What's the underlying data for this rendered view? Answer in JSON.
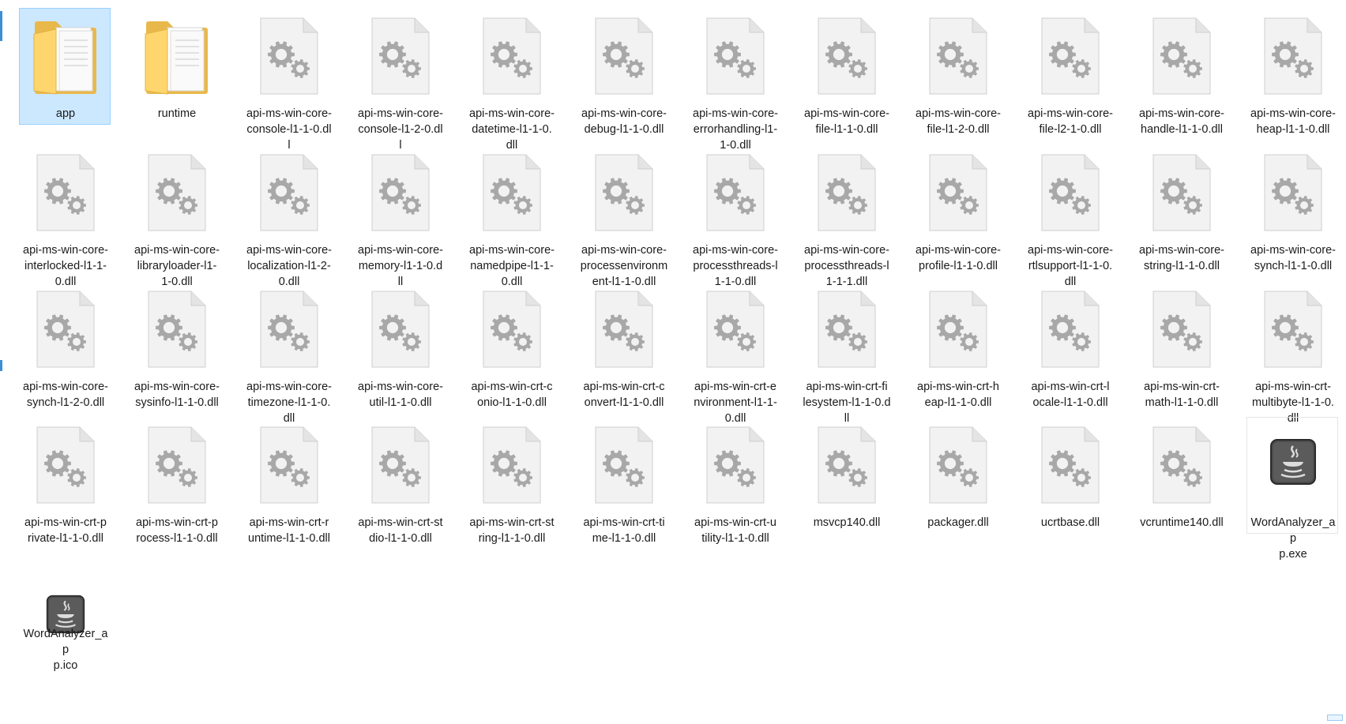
{
  "window": {
    "view": "large-icons"
  },
  "colors": {
    "selection_fill": "#cce8ff",
    "selection_border": "#99d1ff",
    "folder_front": "#ffd66e",
    "folder_back": "#e9b84a",
    "file_page": "#f2f2f2",
    "gear": "#a8a8a8"
  },
  "files": [
    {
      "name": "app",
      "label": "app",
      "icon": "folder-icon",
      "selected": true
    },
    {
      "name": "runtime",
      "label": "runtime",
      "icon": "folder-icon"
    },
    {
      "name": "api-ms-win-core-console-l1-1-0.dll",
      "label": "api-ms-win-core-\nconsole-l1-1-0.dl\nl",
      "icon": "dll-file-icon"
    },
    {
      "name": "api-ms-win-core-console-l1-2-0.dll",
      "label": "api-ms-win-core-\nconsole-l1-2-0.dl\nl",
      "icon": "dll-file-icon"
    },
    {
      "name": "api-ms-win-core-datetime-l1-1-0.dll",
      "label": "api-ms-win-core-\ndatetime-l1-1-0.\ndll",
      "icon": "dll-file-icon"
    },
    {
      "name": "api-ms-win-core-debug-l1-1-0.dll",
      "label": "api-ms-win-core-\ndebug-l1-1-0.dll",
      "icon": "dll-file-icon"
    },
    {
      "name": "api-ms-win-core-errorhandling-l1-1-0.dll",
      "label": "api-ms-win-core-\nerrorhandling-l1-\n1-0.dll",
      "icon": "dll-file-icon"
    },
    {
      "name": "api-ms-win-core-file-l1-1-0.dll",
      "label": "api-ms-win-core-\nfile-l1-1-0.dll",
      "icon": "dll-file-icon"
    },
    {
      "name": "api-ms-win-core-file-l1-2-0.dll",
      "label": "api-ms-win-core-\nfile-l1-2-0.dll",
      "icon": "dll-file-icon"
    },
    {
      "name": "api-ms-win-core-file-l2-1-0.dll",
      "label": "api-ms-win-core-\nfile-l2-1-0.dll",
      "icon": "dll-file-icon"
    },
    {
      "name": "api-ms-win-core-handle-l1-1-0.dll",
      "label": "api-ms-win-core-\nhandle-l1-1-0.dll",
      "icon": "dll-file-icon"
    },
    {
      "name": "api-ms-win-core-heap-l1-1-0.dll",
      "label": "api-ms-win-core-\nheap-l1-1-0.dll",
      "icon": "dll-file-icon"
    },
    {
      "name": "api-ms-win-core-interlocked-l1-1-0.dll",
      "label": "api-ms-win-core-\ninterlocked-l1-1-\n0.dll",
      "icon": "dll-file-icon"
    },
    {
      "name": "api-ms-win-core-libraryloader-l1-1-0.dll",
      "label": "api-ms-win-core-\nlibraryloader-l1-\n1-0.dll",
      "icon": "dll-file-icon"
    },
    {
      "name": "api-ms-win-core-localization-l1-2-0.dll",
      "label": "api-ms-win-core-\nlocalization-l1-2-\n0.dll",
      "icon": "dll-file-icon"
    },
    {
      "name": "api-ms-win-core-memory-l1-1-0.dll",
      "label": "api-ms-win-core-\nmemory-l1-1-0.d\nll",
      "icon": "dll-file-icon"
    },
    {
      "name": "api-ms-win-core-namedpipe-l1-1-0.dll",
      "label": "api-ms-win-core-\nnamedpipe-l1-1-\n0.dll",
      "icon": "dll-file-icon"
    },
    {
      "name": "api-ms-win-core-processenvironment-l1-1-0.dll",
      "label": "api-ms-win-core-\nprocessenvironm\nent-l1-1-0.dll",
      "icon": "dll-file-icon"
    },
    {
      "name": "api-ms-win-core-processthreads-l1-1-0.dll",
      "label": "api-ms-win-core-\nprocessthreads-l\n1-1-0.dll",
      "icon": "dll-file-icon"
    },
    {
      "name": "api-ms-win-core-processthreads-l1-1-1.dll",
      "label": "api-ms-win-core-\nprocessthreads-l\n1-1-1.dll",
      "icon": "dll-file-icon"
    },
    {
      "name": "api-ms-win-core-profile-l1-1-0.dll",
      "label": "api-ms-win-core-\nprofile-l1-1-0.dll",
      "icon": "dll-file-icon"
    },
    {
      "name": "api-ms-win-core-rtlsupport-l1-1-0.dll",
      "label": "api-ms-win-core-\nrtlsupport-l1-1-0.\ndll",
      "icon": "dll-file-icon"
    },
    {
      "name": "api-ms-win-core-string-l1-1-0.dll",
      "label": "api-ms-win-core-\nstring-l1-1-0.dll",
      "icon": "dll-file-icon"
    },
    {
      "name": "api-ms-win-core-synch-l1-1-0.dll",
      "label": "api-ms-win-core-\nsynch-l1-1-0.dll",
      "icon": "dll-file-icon"
    },
    {
      "name": "api-ms-win-core-synch-l1-2-0.dll",
      "label": "api-ms-win-core-\nsynch-l1-2-0.dll",
      "icon": "dll-file-icon"
    },
    {
      "name": "api-ms-win-core-sysinfo-l1-1-0.dll",
      "label": "api-ms-win-core-\nsysinfo-l1-1-0.dll",
      "icon": "dll-file-icon"
    },
    {
      "name": "api-ms-win-core-timezone-l1-1-0.dll",
      "label": "api-ms-win-core-\ntimezone-l1-1-0.\ndll",
      "icon": "dll-file-icon"
    },
    {
      "name": "api-ms-win-core-util-l1-1-0.dll",
      "label": "api-ms-win-core-\nutil-l1-1-0.dll",
      "icon": "dll-file-icon"
    },
    {
      "name": "api-ms-win-crt-conio-l1-1-0.dll",
      "label": "api-ms-win-crt-c\nonio-l1-1-0.dll",
      "icon": "dll-file-icon"
    },
    {
      "name": "api-ms-win-crt-convert-l1-1-0.dll",
      "label": "api-ms-win-crt-c\nonvert-l1-1-0.dll",
      "icon": "dll-file-icon"
    },
    {
      "name": "api-ms-win-crt-environment-l1-1-0.dll",
      "label": "api-ms-win-crt-e\nnvironment-l1-1-\n0.dll",
      "icon": "dll-file-icon"
    },
    {
      "name": "api-ms-win-crt-filesystem-l1-1-0.dll",
      "label": "api-ms-win-crt-fi\nlesystem-l1-1-0.d\nll",
      "icon": "dll-file-icon"
    },
    {
      "name": "api-ms-win-crt-heap-l1-1-0.dll",
      "label": "api-ms-win-crt-h\neap-l1-1-0.dll",
      "icon": "dll-file-icon"
    },
    {
      "name": "api-ms-win-crt-locale-l1-1-0.dll",
      "label": "api-ms-win-crt-l\nocale-l1-1-0.dll",
      "icon": "dll-file-icon"
    },
    {
      "name": "api-ms-win-crt-math-l1-1-0.dll",
      "label": "api-ms-win-crt-\nmath-l1-1-0.dll",
      "icon": "dll-file-icon"
    },
    {
      "name": "api-ms-win-crt-multibyte-l1-1-0.dll",
      "label": "api-ms-win-crt-\nmultibyte-l1-1-0.\ndll",
      "icon": "dll-file-icon"
    },
    {
      "name": "api-ms-win-crt-private-l1-1-0.dll",
      "label": "api-ms-win-crt-p\nrivate-l1-1-0.dll",
      "icon": "dll-file-icon"
    },
    {
      "name": "api-ms-win-crt-process-l1-1-0.dll",
      "label": "api-ms-win-crt-p\nrocess-l1-1-0.dll",
      "icon": "dll-file-icon"
    },
    {
      "name": "api-ms-win-crt-runtime-l1-1-0.dll",
      "label": "api-ms-win-crt-r\nuntime-l1-1-0.dll",
      "icon": "dll-file-icon"
    },
    {
      "name": "api-ms-win-crt-stdio-l1-1-0.dll",
      "label": "api-ms-win-crt-st\ndio-l1-1-0.dll",
      "icon": "dll-file-icon"
    },
    {
      "name": "api-ms-win-crt-string-l1-1-0.dll",
      "label": "api-ms-win-crt-st\nring-l1-1-0.dll",
      "icon": "dll-file-icon"
    },
    {
      "name": "api-ms-win-crt-time-l1-1-0.dll",
      "label": "api-ms-win-crt-ti\nme-l1-1-0.dll",
      "icon": "dll-file-icon"
    },
    {
      "name": "api-ms-win-crt-utility-l1-1-0.dll",
      "label": "api-ms-win-crt-u\ntility-l1-1-0.dll",
      "icon": "dll-file-icon"
    },
    {
      "name": "msvcp140.dll",
      "label": "msvcp140.dll",
      "icon": "dll-file-icon"
    },
    {
      "name": "packager.dll",
      "label": "packager.dll",
      "icon": "dll-file-icon"
    },
    {
      "name": "ucrtbase.dll",
      "label": "ucrtbase.dll",
      "icon": "dll-file-icon"
    },
    {
      "name": "vcruntime140.dll",
      "label": "vcruntime140.dll",
      "icon": "dll-file-icon"
    },
    {
      "name": "WordAnalyzer_app.exe",
      "label": "WordAnalyzer_ap\np.exe",
      "icon": "java-app-icon",
      "hovered": true
    },
    {
      "name": "WordAnalyzer_app.ico",
      "label": "WordAnalyzer_ap\np.ico",
      "icon": "java-app-icon"
    }
  ]
}
